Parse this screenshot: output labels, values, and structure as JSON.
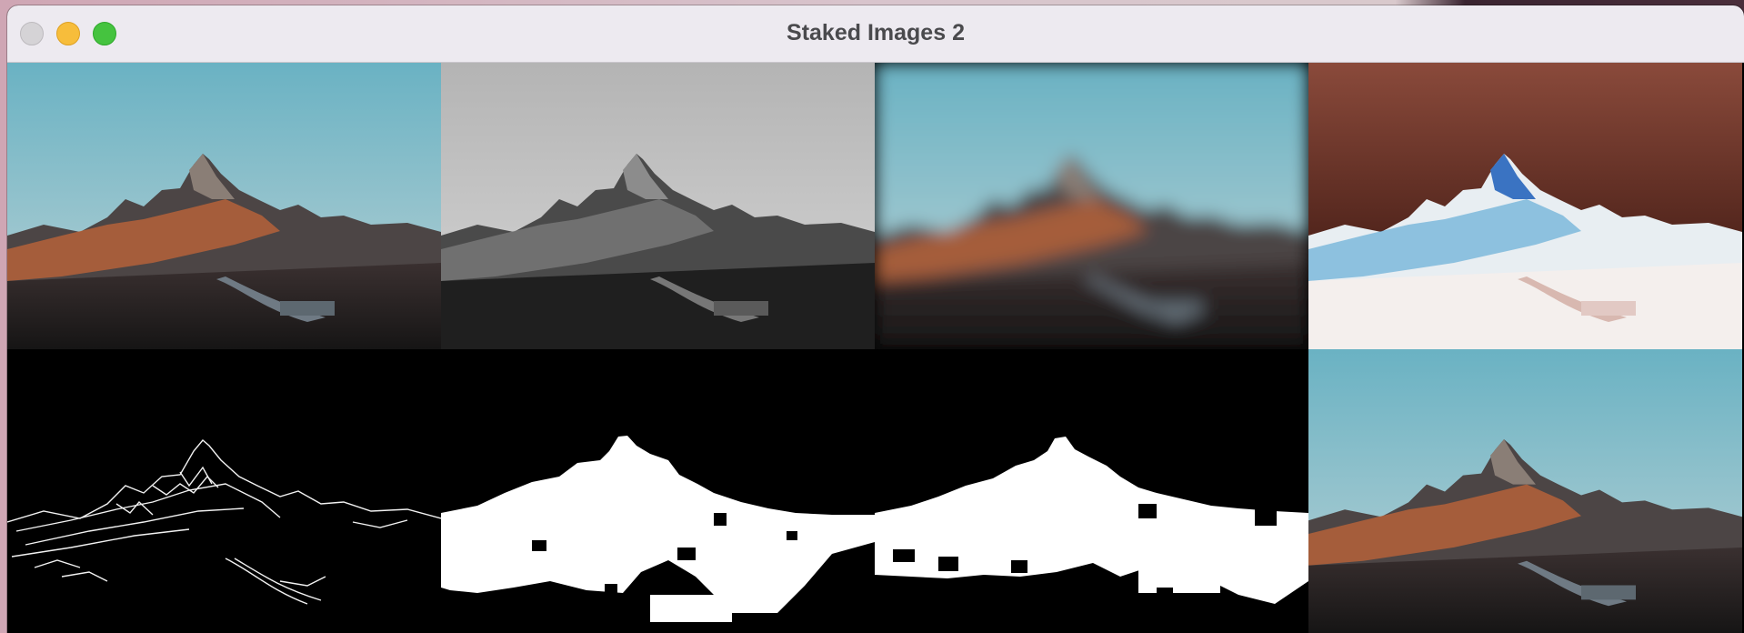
{
  "window": {
    "title": "Staked Images 2"
  },
  "traffic_lights": [
    {
      "name": "close",
      "color": "#d5d3d6"
    },
    {
      "name": "minimize",
      "color": "#f7bd3b"
    },
    {
      "name": "maximize",
      "color": "#45c33f"
    }
  ],
  "panels": {
    "original": "color",
    "grayscale": "grayscale",
    "blurred": "blur",
    "inverted": "invert",
    "edges": "edge-lines",
    "threshold_a": "binary-mask",
    "threshold_b": "binary-mask",
    "original_repeat": "color"
  }
}
